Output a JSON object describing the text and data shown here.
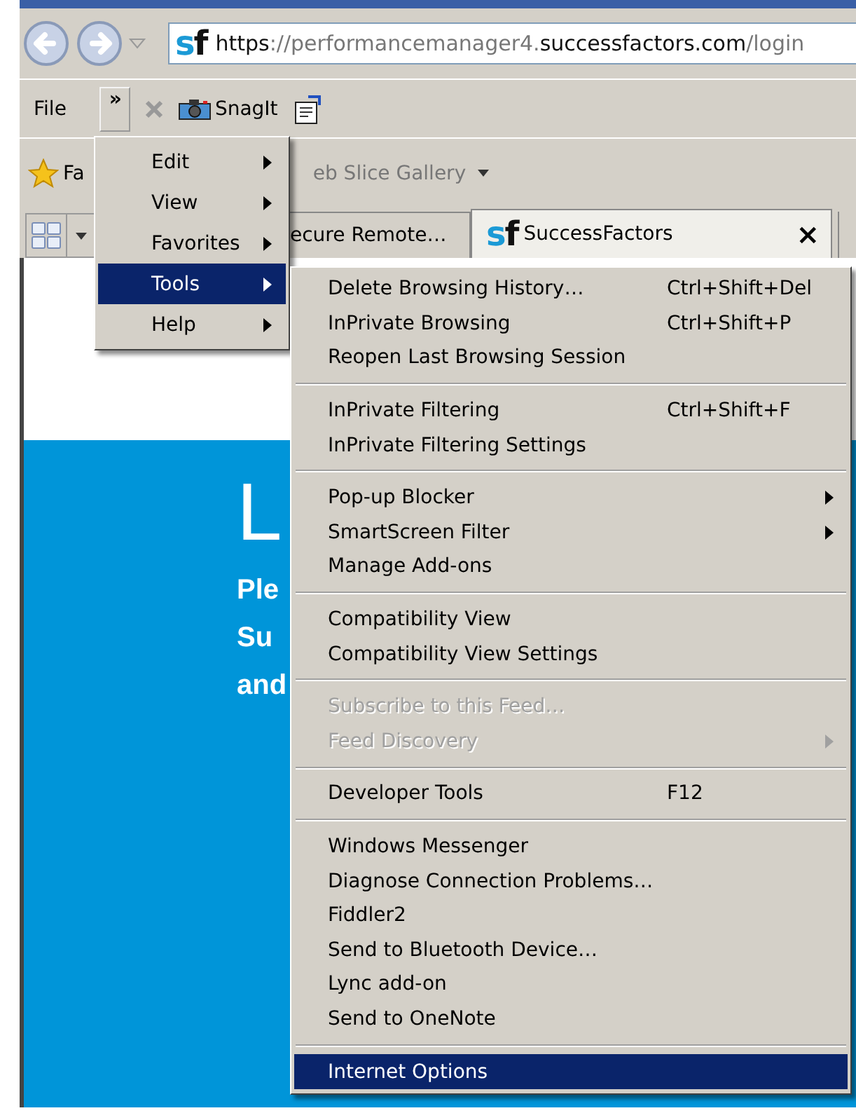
{
  "address_bar": {
    "logo": "sf",
    "url": [
      {
        "text": "https",
        "emphasis": true
      },
      {
        "text": "://performancemanager4.",
        "emphasis": false
      },
      {
        "text": "successfactors.com",
        "emphasis": true
      },
      {
        "text": "/login",
        "emphasis": false
      }
    ]
  },
  "menu_bar": {
    "file": "File",
    "chevron": "»",
    "snagit": "SnagIt"
  },
  "favorites_bar": {
    "favorites": "Fa",
    "web_slice": "eb Slice Gallery"
  },
  "tabs": [
    {
      "label": "ecure Remote…",
      "selected": false
    },
    {
      "label": "SuccessFactors",
      "selected": true,
      "logo": "sf",
      "close": "×"
    }
  ],
  "page": {
    "heading": "L",
    "lines": [
      "Ple",
      "Su",
      "and"
    ]
  },
  "menu": {
    "items": [
      {
        "label": "Edit",
        "selected": false
      },
      {
        "label": "View",
        "selected": false
      },
      {
        "label": "Favorites",
        "selected": false
      },
      {
        "label": "Tools",
        "selected": true
      },
      {
        "label": "Help",
        "selected": false
      }
    ]
  },
  "submenu": {
    "items": [
      {
        "kind": "item",
        "label": "Delete Browsing History…",
        "shortcut": "Ctrl+Shift+Del",
        "disabled": false,
        "submenu": false,
        "selected": false
      },
      {
        "kind": "item",
        "label": "InPrivate Browsing",
        "shortcut": "Ctrl+Shift+P",
        "disabled": false,
        "submenu": false,
        "selected": false
      },
      {
        "kind": "item",
        "label": "Reopen Last Browsing Session",
        "disabled": false,
        "submenu": false,
        "selected": false
      },
      {
        "kind": "separator"
      },
      {
        "kind": "item",
        "label": "InPrivate Filtering",
        "shortcut": "Ctrl+Shift+F",
        "disabled": false,
        "submenu": false,
        "selected": false
      },
      {
        "kind": "item",
        "label": "InPrivate Filtering Settings",
        "disabled": false,
        "submenu": false,
        "selected": false
      },
      {
        "kind": "separator"
      },
      {
        "kind": "item",
        "label": "Pop-up Blocker",
        "disabled": false,
        "submenu": true,
        "selected": false
      },
      {
        "kind": "item",
        "label": "SmartScreen Filter",
        "disabled": false,
        "submenu": true,
        "selected": false
      },
      {
        "kind": "item",
        "label": "Manage Add-ons",
        "disabled": false,
        "submenu": false,
        "selected": false
      },
      {
        "kind": "separator"
      },
      {
        "kind": "item",
        "label": "Compatibility View",
        "disabled": false,
        "submenu": false,
        "selected": false
      },
      {
        "kind": "item",
        "label": "Compatibility View Settings",
        "disabled": false,
        "submenu": false,
        "selected": false
      },
      {
        "kind": "separator"
      },
      {
        "kind": "item",
        "label": "Subscribe to this Feed…",
        "disabled": true,
        "submenu": false,
        "selected": false
      },
      {
        "kind": "item",
        "label": "Feed Discovery",
        "disabled": true,
        "submenu": true,
        "selected": false
      },
      {
        "kind": "separator"
      },
      {
        "kind": "item",
        "label": "Developer Tools",
        "shortcut": "F12",
        "disabled": false,
        "submenu": false,
        "selected": false
      },
      {
        "kind": "separator"
      },
      {
        "kind": "item",
        "label": "Windows Messenger",
        "disabled": false,
        "submenu": false,
        "selected": false
      },
      {
        "kind": "item",
        "label": "Diagnose Connection Problems…",
        "disabled": false,
        "submenu": false,
        "selected": false
      },
      {
        "kind": "item",
        "label": "Fiddler2",
        "disabled": false,
        "submenu": false,
        "selected": false
      },
      {
        "kind": "item",
        "label": "Send to Bluetooth Device…",
        "disabled": false,
        "submenu": false,
        "selected": false
      },
      {
        "kind": "item",
        "label": "Lync add-on",
        "disabled": false,
        "submenu": false,
        "selected": false
      },
      {
        "kind": "item",
        "label": "Send to OneNote",
        "disabled": false,
        "submenu": false,
        "selected": false
      },
      {
        "kind": "separator"
      },
      {
        "kind": "item",
        "label": "Internet Options",
        "disabled": false,
        "submenu": false,
        "selected": true
      }
    ]
  }
}
